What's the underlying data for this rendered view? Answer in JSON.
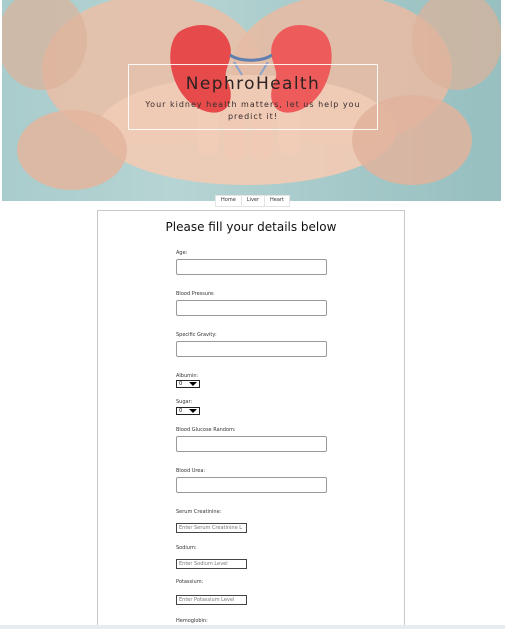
{
  "hero": {
    "title": "NephroHealth",
    "tagline": "Your kidney health matters, let us help you predict it!"
  },
  "nav": {
    "items": [
      "Home",
      "Liver",
      "Heart"
    ]
  },
  "form": {
    "title": "Please fill your details below",
    "age_label": "Age:",
    "bp_label": "Blood Pressure:",
    "sg_label": "Specific Gravity:",
    "albumin_label": "Albumin:",
    "albumin_value": "0",
    "sugar_label": "Sugar:",
    "sugar_value": "0",
    "bgr_label": "Blood Glucose Random:",
    "bu_label": "Blood Urea:",
    "sc_label": "Serum Creatinine:",
    "sc_placeholder": "Enter Serum Creatinine L",
    "sodium_label": "Sodium:",
    "sodium_placeholder": "Enter Sodium Level",
    "potassium_label": "Potassium:",
    "potassium_placeholder": "Enter Potassium Level",
    "hemo_label": "Hemoglobin:"
  }
}
